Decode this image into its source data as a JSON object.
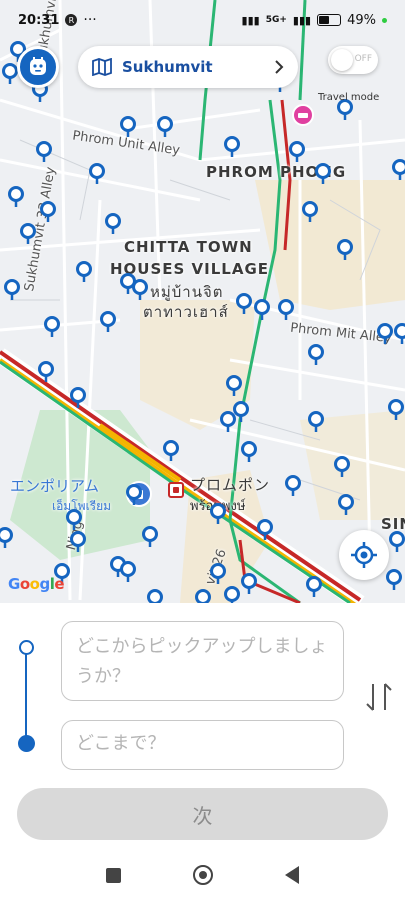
{
  "status_bar": {
    "time": "20:31",
    "network": "5G+",
    "battery_percent": "49%",
    "battery_level": 0.49
  },
  "header": {
    "location_label": "Sukhumvit",
    "travel_mode_label": "Travel mode",
    "travel_toggle_text": "OFF"
  },
  "map": {
    "labels": {
      "phrom_unit_alley": "Phrom Unit Alley",
      "phrom_phong": "PHROM PHONG",
      "chitta_line1": "CHITTA TOWN",
      "chitta_line2": "HOUSES VILLAGE",
      "chitta_thai1": "หมู่บ้านจิต",
      "chitta_thai2": "ตาทาวเฮาส์",
      "phrom_mit_alley": "Phrom Mit Alley",
      "sukhumvit_33_alley": "Sukhumvit 33 Alley",
      "sukhumvit_vertical": "Sukhumvit",
      "emporium_jp": "エンポリアム",
      "emporium_th": "เอ็มโพเรียม",
      "phrom_phong_station_jp": "プロムポン",
      "phrom_phong_station_th": "พร้อมพงษ์",
      "vit26": "vit 26",
      "sin": "SIN",
      "ning": "Ning"
    },
    "google": "Google"
  },
  "form": {
    "pickup_placeholder": "どこからピックアップしましょうか？",
    "destination_placeholder": "どこまで？",
    "next_label": "次"
  },
  "colors": {
    "accent": "#1565c0",
    "pin": "#1565c0",
    "transit": "#2bb673",
    "traffic_red": "#c62828",
    "traffic_yellow": "#f4b400"
  },
  "icons": {
    "avatar": "robot-avatar-icon",
    "map": "map-icon",
    "chevron": "chevron-right-icon",
    "locate": "crosshair-icon",
    "swap": "swap-vertical-icon",
    "hotel": "hotel-icon"
  }
}
